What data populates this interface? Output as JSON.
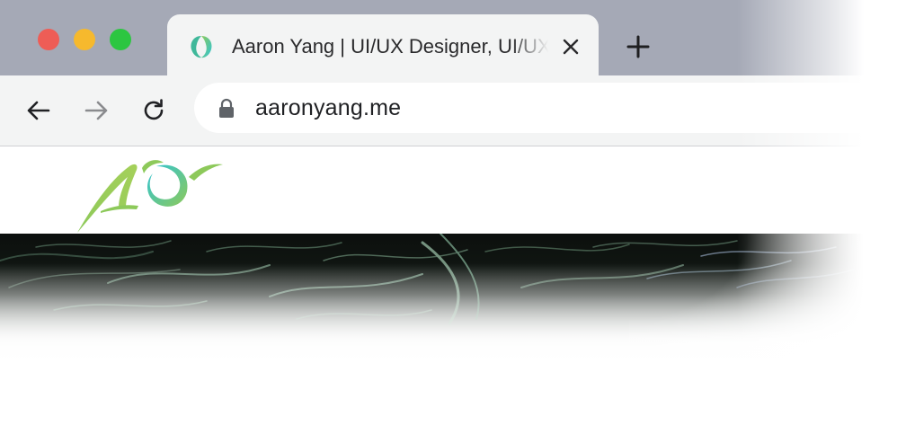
{
  "window": {
    "controls": {
      "close_color": "#ee5d56",
      "minimize_color": "#f6b92d",
      "maximize_color": "#2cc641"
    }
  },
  "tab": {
    "title": "Aaron Yang | UI/UX Designer, UI/UX Developer",
    "favicon": "aaron-yang-logo-icon",
    "close_icon": "close-icon"
  },
  "tabstrip": {
    "new_tab_icon": "plus-icon"
  },
  "toolbar": {
    "back_icon": "arrow-left-icon",
    "forward_icon": "arrow-right-icon",
    "reload_icon": "reload-icon",
    "lock_icon": "lock-icon",
    "url": "aaronyang.me"
  },
  "site": {
    "logo_icon": "ao-logo-icon",
    "brand_colors": {
      "green": "#8dc95a",
      "teal": "#2ec4d6",
      "hero_dark": "#0c0f0d"
    }
  }
}
